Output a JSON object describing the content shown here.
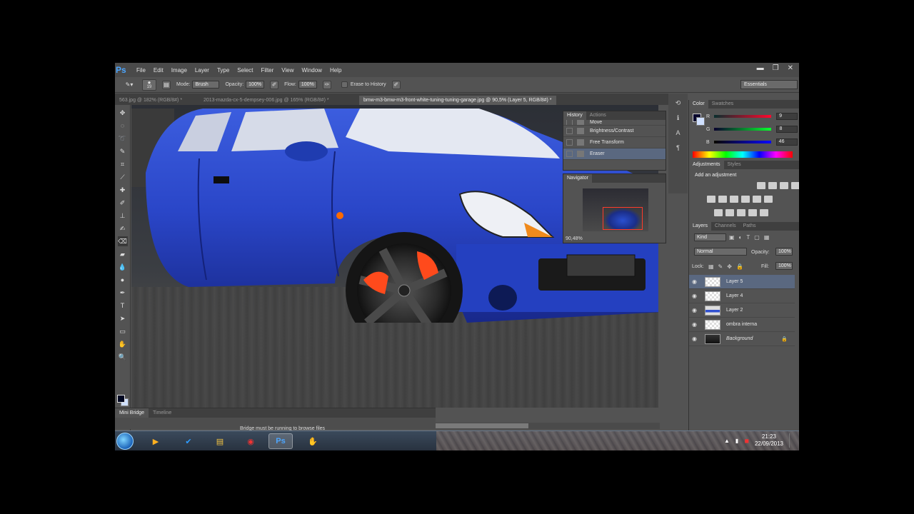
{
  "app": {
    "logo": "Ps",
    "window_controls": [
      "▬",
      "❐",
      "✕"
    ]
  },
  "menu": [
    "File",
    "Edit",
    "Image",
    "Layer",
    "Type",
    "Select",
    "Filter",
    "View",
    "Window",
    "Help"
  ],
  "options": {
    "brush_size": "19",
    "mode_label": "Mode:",
    "mode_value": "Brush",
    "opacity_label": "Opacity:",
    "opacity_value": "100%",
    "flow_label": "Flow:",
    "flow_value": "100%",
    "erase_history": "Erase to History",
    "workspace": "Essentials"
  },
  "tabs": [
    "563.jpg @ 182% (RGB/8#) *",
    "2013-mazda-cx-5-dempsey-006.jpg @ 165% (RGB/8#) *",
    "bmw-m3-bmw-m3-front-white-tuning-tuning-garage.jpg @ 90,5% (Layer 5, RGB/8#) *"
  ],
  "history": {
    "tabs": [
      "History",
      "Actions"
    ],
    "items": [
      "Move",
      "Brightness/Contrast",
      "Free Transform",
      "Eraser"
    ]
  },
  "navigator": {
    "title": "Navigator",
    "zoom": "90,48%"
  },
  "color": {
    "tabs": [
      "Color",
      "Swatches"
    ],
    "r_label": "R",
    "r_value": "9",
    "g_label": "G",
    "g_value": "8",
    "b_label": "B",
    "b_value": "46",
    "fg": "#09082e"
  },
  "adjustments": {
    "tabs": [
      "Adjustments",
      "Styles"
    ],
    "hint": "Add an adjustment"
  },
  "layers": {
    "tabs": [
      "Layers",
      "Channels",
      "Paths"
    ],
    "kind": "Kind",
    "blend": "Normal",
    "opacity_label": "Opacity:",
    "opacity_value": "100%",
    "lock_label": "Lock:",
    "fill_label": "Fill:",
    "fill_value": "100%",
    "items": [
      "Layer 5",
      "Layer 4",
      "Layer 2",
      "ombra interna",
      "Background"
    ]
  },
  "minibridge": {
    "tabs": [
      "Mini Bridge",
      "Timeline"
    ],
    "message": "Bridge must be running to browse files"
  },
  "taskbar": {
    "time": "21:23",
    "date": "22/09/2013",
    "ps_label": "Ps"
  }
}
